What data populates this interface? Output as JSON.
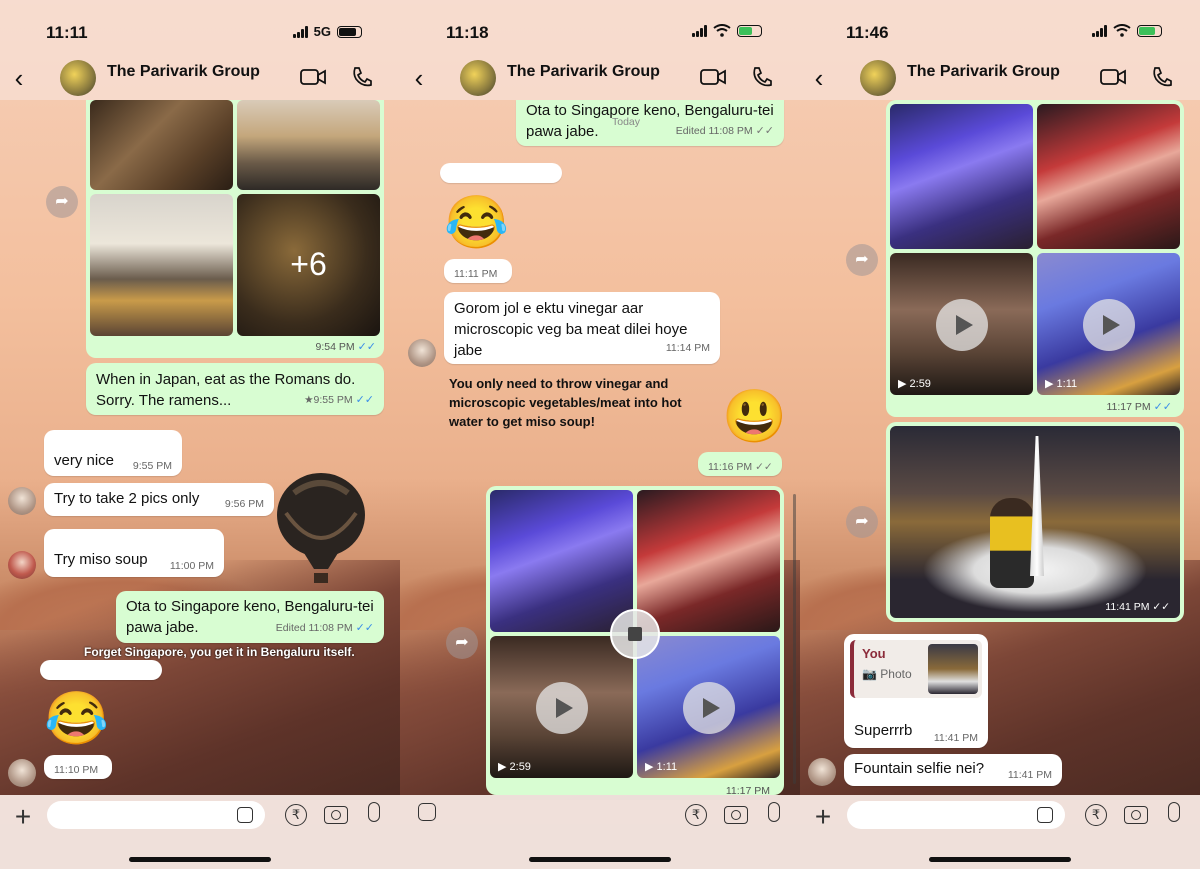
{
  "chat": {
    "title": "The Parivarik Group"
  },
  "screens": [
    {
      "time": "11:11",
      "network": "5G",
      "messages": {
        "photos_time": "9:54 PM",
        "more_count": "+6",
        "m1_text": "When in Japan, eat as the Romans do. Sorry. The ramens...",
        "m1_time": "★9:55 PM",
        "m2_text": "very nice",
        "m2_time": "9:55 PM",
        "m3_text": "Try to take 2 pics only",
        "m3_time": "9:56 PM",
        "m4_text": "Try miso soup",
        "m4_time": "11:00 PM",
        "m5_text": "Ota to Singapore keno, Bengaluru-tei pawa jabe.",
        "m5_time": "Edited 11:08 PM",
        "m5_caption": "Forget Singapore, you get it in Bengaluru itself.",
        "emoji": "😂",
        "emoji_time": "11:10 PM"
      }
    },
    {
      "time": "11:18",
      "messages": {
        "m1_text": "Ota to Singapore keno, Bengaluru-tei pawa jabe.",
        "m1_time": "Edited 11:08 PM",
        "today": "Today",
        "emoji": "😂",
        "emoji_time": "11:11 PM",
        "m2_text": "Gorom jol e ektu vinegar aar microscopic veg ba meat dilei hoye jabe",
        "m2_time": "11:14 PM",
        "m2_caption": "You only need to throw vinegar and microscopic vegetables/meat into hot water to get miso soup!",
        "emoji2": "😃",
        "emoji2_time": "11:16 PM",
        "v1_dur": "2:59",
        "v2_dur": "1:11",
        "media_time": "11:17 PM"
      }
    },
    {
      "time": "11:46",
      "messages": {
        "v1_dur": "2:59",
        "v2_dur": "1:11",
        "media_time": "11:17 PM",
        "photo_time": "11:41 PM",
        "reply_who": "You",
        "reply_label": "Photo",
        "r_text": "Superrrb",
        "r_time": "11:41 PM",
        "f_text": "Fountain selfie nei?",
        "f_time": "11:41 PM"
      }
    }
  ],
  "input": {
    "rupee": "₹"
  }
}
